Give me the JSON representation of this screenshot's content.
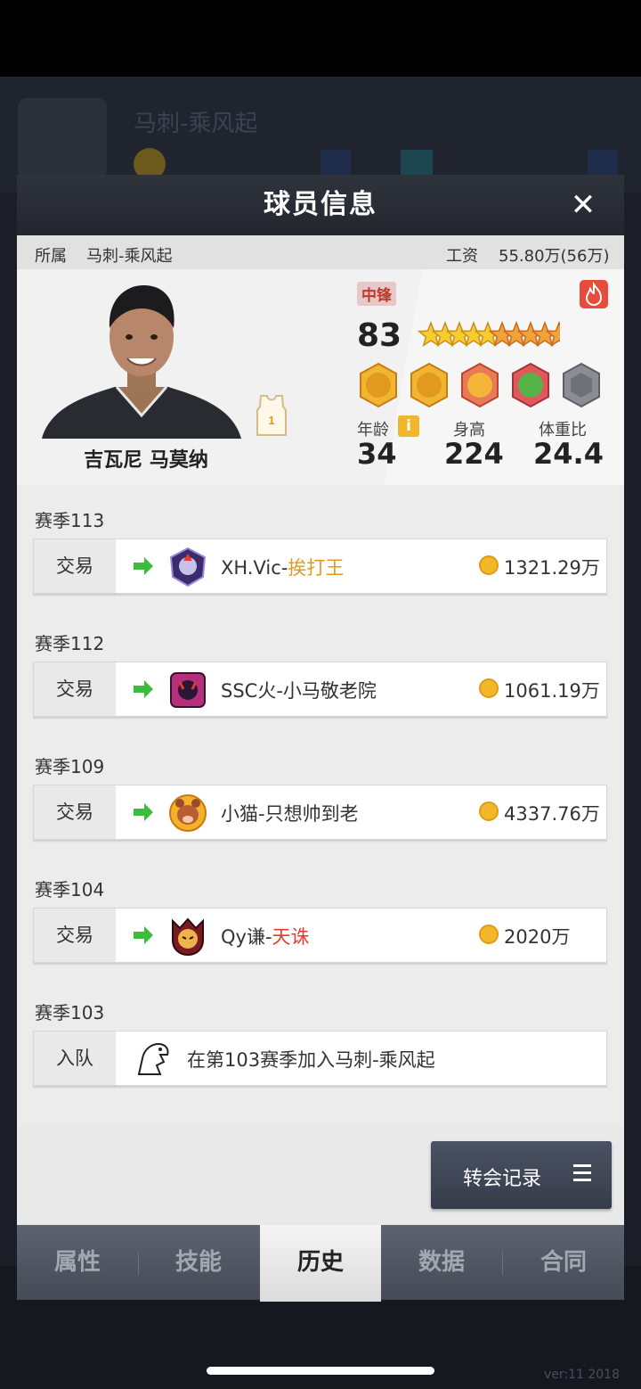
{
  "modal": {
    "title": "球员信息",
    "close_label": "✕"
  },
  "info_bar": {
    "team_label": "所属",
    "team_name": "马刺-乘风起",
    "salary_label": "工资",
    "salary_value": "55.80万(56万)"
  },
  "player": {
    "name": "吉瓦尼 马莫纳",
    "jersey_number": "1",
    "position": "中锋",
    "rating": "83",
    "stars_filled": 5,
    "stars_total": 10,
    "age_label": "年龄",
    "age": "34",
    "height_label": "身高",
    "height": "224",
    "weight_ratio_label": "体重比",
    "weight_ratio": "24.4",
    "info_icon": "i"
  },
  "history": [
    {
      "season": "赛季113",
      "type": "交易",
      "team_prefix": "XH.Vic-",
      "team_suffix": "挨打王",
      "suffix_color": "#e09a1a",
      "fee": "1321.29万"
    },
    {
      "season": "赛季112",
      "type": "交易",
      "team_prefix": "SSC火-小马敬老院",
      "team_suffix": "",
      "suffix_color": "#333333",
      "fee": "1061.19万"
    },
    {
      "season": "赛季109",
      "type": "交易",
      "team_prefix": "小猫-只想帅到老",
      "team_suffix": "",
      "suffix_color": "#333333",
      "fee": "4337.76万"
    },
    {
      "season": "赛季104",
      "type": "交易",
      "team_prefix": "Qy谦-",
      "team_suffix": "天诛",
      "suffix_color": "#e63b2e",
      "fee": "2020万"
    },
    {
      "season": "赛季103",
      "type": "入队",
      "text": "在第103赛季加入马刺-乘风起"
    }
  ],
  "transfer_button": {
    "label": "转会记录"
  },
  "tabs": [
    {
      "label": "属性",
      "active": false
    },
    {
      "label": "技能",
      "active": false
    },
    {
      "label": "历史",
      "active": true
    },
    {
      "label": "数据",
      "active": false
    },
    {
      "label": "合同",
      "active": false
    }
  ],
  "background": {
    "team_name": "马刺-乘风起",
    "version": "ver:11 2018"
  },
  "colors": {
    "accent_orange": "#e09a1a",
    "accent_red": "#e63b2e",
    "arrow_green": "#3dbb3d",
    "coin_gold": "#f3b82a"
  }
}
